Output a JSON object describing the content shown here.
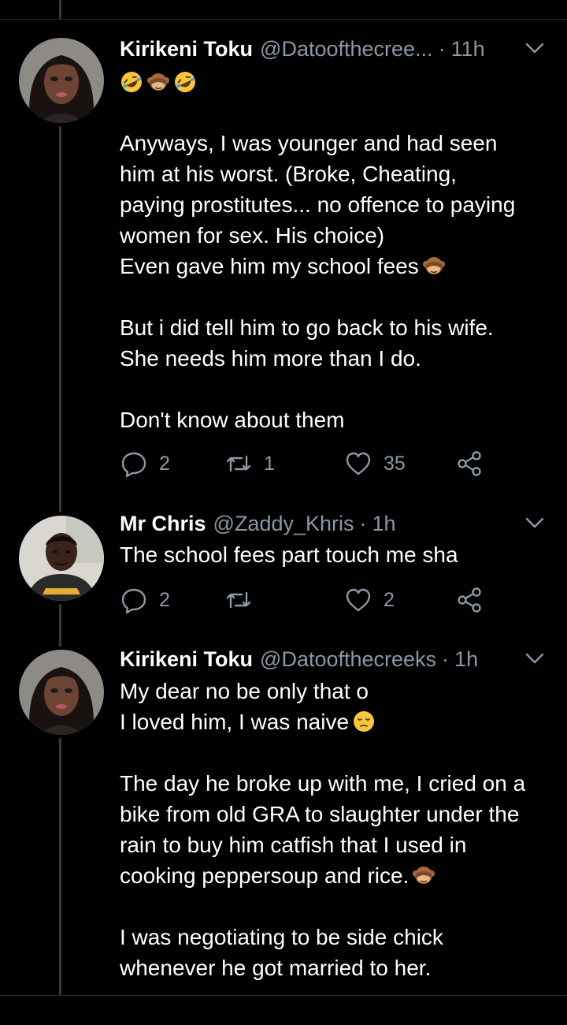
{
  "tweets": [
    {
      "name": "Kirikeni Toku",
      "handle": "@Datoofthecree...",
      "time": "11h",
      "emoji_line": [
        "rofl-emoji",
        "see-no-evil-monkey-emoji",
        "rofl-emoji"
      ],
      "paragraphs": [
        [
          "Anyways, I was younger and had seen",
          "him at his worst. (Broke, Cheating,",
          "paying prostitutes... no offence to paying",
          "women for sex. His choice)",
          "Even gave him my school fees"
        ],
        [
          "But i did tell him to go back to his wife.",
          "She needs him more than I do."
        ],
        [
          "Don't know about them"
        ]
      ],
      "replies": "2",
      "retweets": "1",
      "likes": "35"
    },
    {
      "name": "Mr Chris",
      "handle": "@Zaddy_Khris",
      "time": "1h",
      "text": "The school fees part touch me sha",
      "replies": "2",
      "retweets": "",
      "likes": "2"
    },
    {
      "name": "Kirikeni Toku",
      "handle": "@Datoofthecreeks",
      "time": "1h",
      "paragraphs": [
        [
          "My dear no be only that o",
          "I loved him, I was naive"
        ],
        [
          "The day he broke up with me, I cried on a",
          "bike from old GRA to slaughter under the",
          "rain to buy him catfish that I used in",
          "cooking peppersoup and rice."
        ],
        [
          "I was negotiating to be side chick",
          "whenever he got married to her."
        ]
      ]
    }
  ],
  "colors": {
    "background": "#000000",
    "text": "#ffffff",
    "secondary": "#8b98a5",
    "thread_line": "#3a3a3a",
    "rofl_emoji": "#f7c63a",
    "monkey_emoji": "#a8673a"
  },
  "icons": [
    "reply-icon",
    "retweet-icon",
    "like-icon",
    "share-icon",
    "chevron-down-icon"
  ]
}
